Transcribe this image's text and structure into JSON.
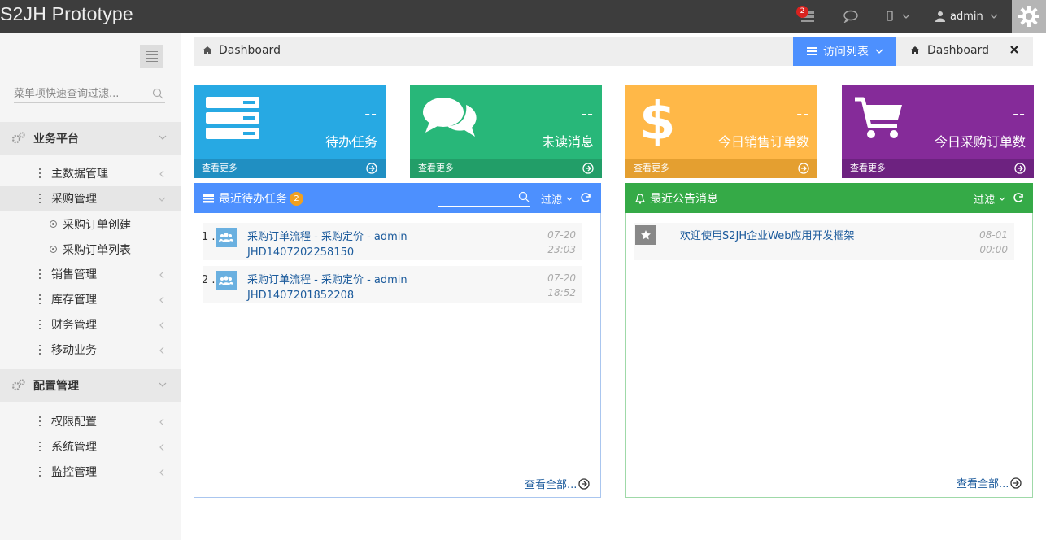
{
  "topbar": {
    "brand": "S2JH Prototype",
    "notify_count": "2",
    "user_name": "admin"
  },
  "sidebar": {
    "search_placeholder": "菜单项快速查询过滤...",
    "groups": [
      {
        "label": "业务平台"
      },
      {
        "label": "配置管理"
      }
    ],
    "items": [
      {
        "label": "主数据管理"
      },
      {
        "label": "采购管理"
      },
      {
        "label": "采购订单创建"
      },
      {
        "label": "采购订单列表"
      },
      {
        "label": "销售管理"
      },
      {
        "label": "库存管理"
      },
      {
        "label": "财务管理"
      },
      {
        "label": "移动业务"
      },
      {
        "label": "权限配置"
      },
      {
        "label": "系统管理"
      },
      {
        "label": "监控管理"
      }
    ]
  },
  "breadcrumb": {
    "label": "Dashboard",
    "visit_list": "访问列表",
    "tab_label": "Dashboard"
  },
  "tiles": [
    {
      "value": "--",
      "label": "待办任务",
      "more": "查看更多",
      "color": "#27a9e3"
    },
    {
      "value": "--",
      "label": "未读消息",
      "more": "查看更多",
      "color": "#28b779"
    },
    {
      "value": "--",
      "label": "今日销售订单数",
      "more": "查看更多",
      "color": "#ffb848"
    },
    {
      "value": "--",
      "label": "今日采购订单数",
      "more": "查看更多",
      "color": "#852b99"
    }
  ],
  "todo_panel": {
    "title": "最近待办任务",
    "badge": "2",
    "filter": "过滤",
    "items": [
      {
        "num": "1 .",
        "title": "采购订单流程 - 采购定价 - admin",
        "sub": "JHD1407202258150",
        "date": "07-20",
        "time": "23:03"
      },
      {
        "num": "2 .",
        "title": "采购订单流程 - 采购定价 - admin",
        "sub": "JHD1407201852208",
        "date": "07-20",
        "time": "18:52"
      }
    ],
    "see_all": "查看全部..."
  },
  "notice_panel": {
    "title": "最近公告消息",
    "filter": "过滤",
    "items": [
      {
        "title": "欢迎使用S2JH企业Web应用开发框架",
        "date": "08-01",
        "time": "00:00"
      }
    ],
    "see_all": "查看全部..."
  },
  "colors": {
    "todo_header": "#4d90fe",
    "notice_header": "#35aa47"
  }
}
